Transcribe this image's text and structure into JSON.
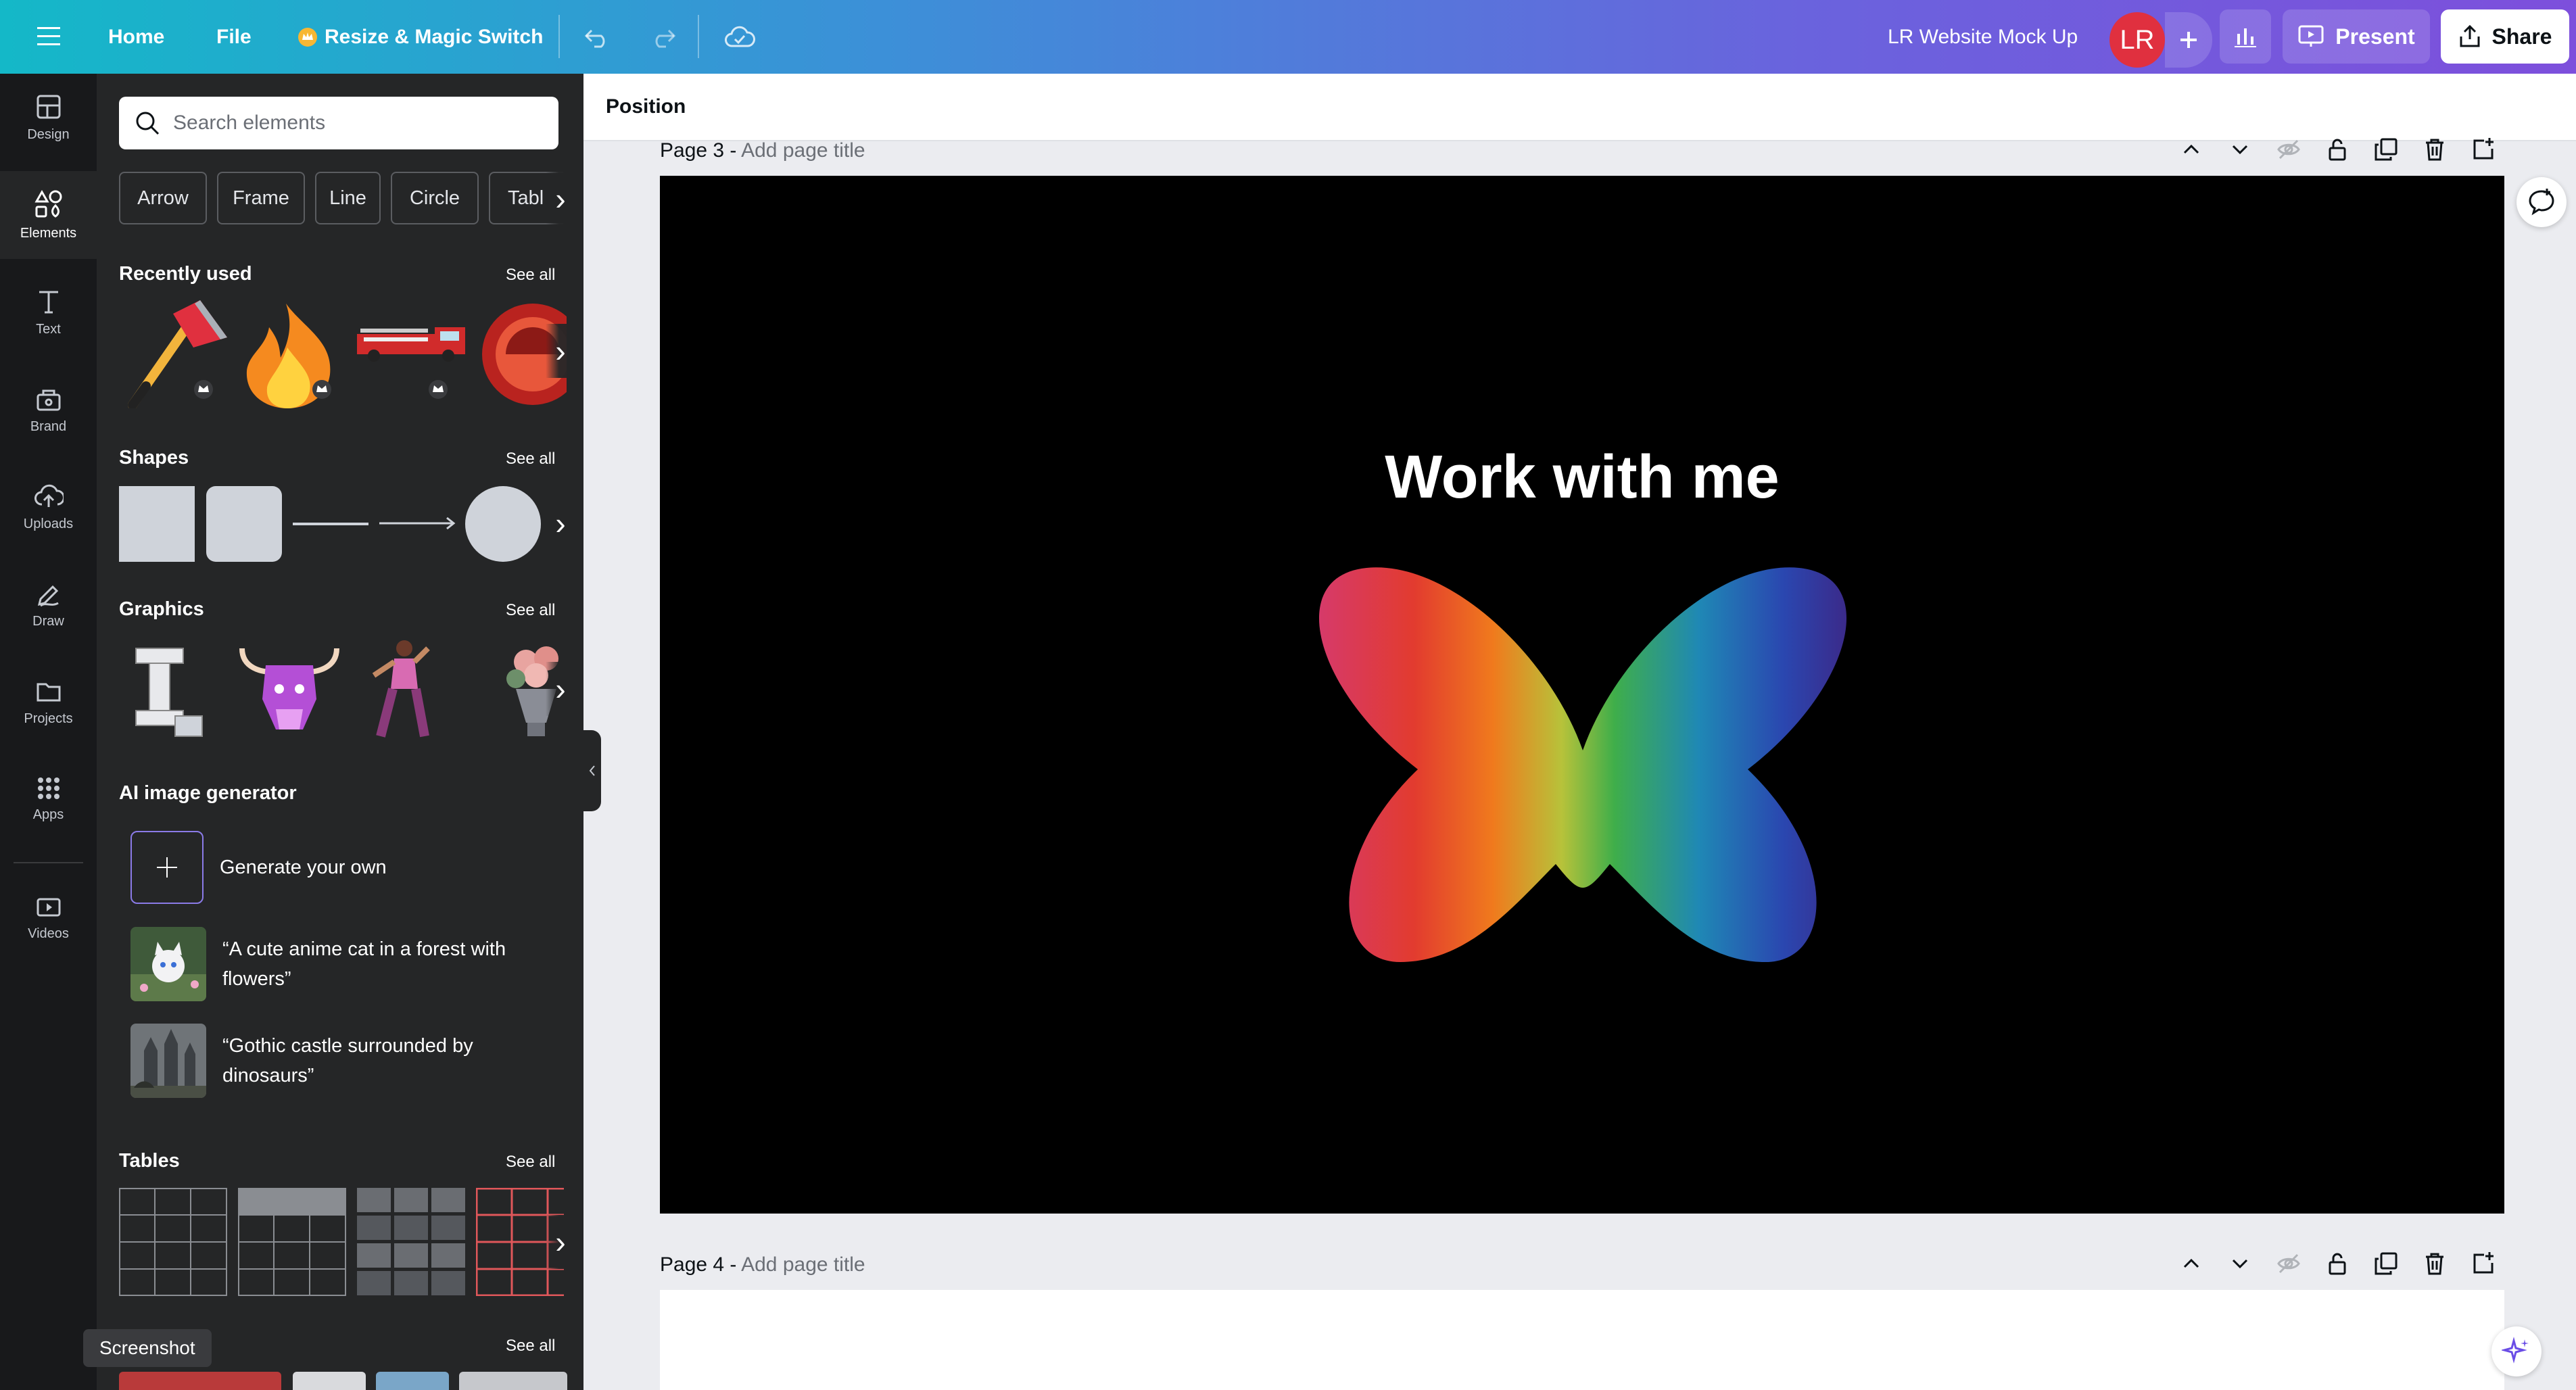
{
  "topbar": {
    "home": "Home",
    "file": "File",
    "resize": "Resize & Magic Switch",
    "doc_title": "LR Website Mock Up",
    "avatar_initials": "LR",
    "present": "Present",
    "share": "Share"
  },
  "rail": {
    "items": [
      {
        "label": "Design",
        "icon": "design-icon"
      },
      {
        "label": "Elements",
        "icon": "elements-icon"
      },
      {
        "label": "Text",
        "icon": "text-icon"
      },
      {
        "label": "Brand",
        "icon": "brand-icon"
      },
      {
        "label": "Uploads",
        "icon": "uploads-icon"
      },
      {
        "label": "Draw",
        "icon": "draw-icon"
      },
      {
        "label": "Projects",
        "icon": "projects-icon"
      },
      {
        "label": "Apps",
        "icon": "apps-icon"
      },
      {
        "label": "Videos",
        "icon": "videos-icon"
      }
    ]
  },
  "panel": {
    "search_placeholder": "Search elements",
    "chips": [
      "Arrow",
      "Frame",
      "Line",
      "Circle",
      "Tabl"
    ],
    "recently_used": "Recently used",
    "shapes": "Shapes",
    "graphics": "Graphics",
    "ai_generator": "AI image generator",
    "generate_own": "Generate your own",
    "prompt1": "“A cute anime cat in a forest with flowers”",
    "prompt2": "“Gothic castle surrounded by dinosaurs”",
    "tables": "Tables",
    "see_all": "See all",
    "tooltip": "Screenshot"
  },
  "canvas": {
    "context_label": "Position",
    "page3_label": "Page 3 -",
    "page4_label": "Page 4 -",
    "add_title": "Add page title",
    "page3_heading": "Work with me"
  },
  "colors": {
    "rail_bg": "#18191b",
    "panel_bg": "#252627",
    "avatar": "#e0303f"
  }
}
